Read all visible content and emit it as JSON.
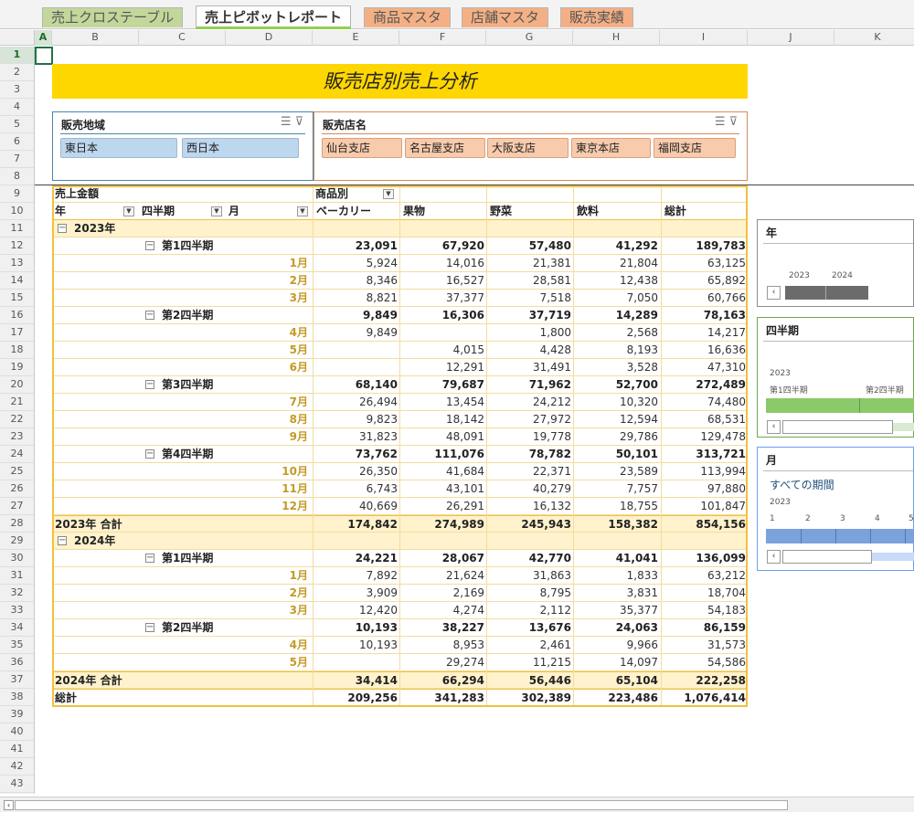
{
  "tabs": [
    {
      "label": "売上クロステーブル",
      "bg": "#c4d79b"
    },
    {
      "label": "売上ピボットレポート",
      "bg": "#ffffff"
    },
    {
      "label": "商品マスタ",
      "bg": "#f4b084"
    },
    {
      "label": "店舗マスタ",
      "bg": "#f4b084"
    },
    {
      "label": "販売実績",
      "bg": "#f4b084"
    }
  ],
  "columns": [
    "A",
    "B",
    "C",
    "D",
    "E",
    "F",
    "G",
    "H",
    "I",
    "J",
    "K"
  ],
  "rows": [
    "1",
    "2",
    "3",
    "4",
    "5",
    "6",
    "7",
    "8",
    "9",
    "10",
    "11",
    "12",
    "13",
    "14",
    "15",
    "16",
    "17",
    "18",
    "19",
    "20",
    "21",
    "22",
    "23",
    "24",
    "25",
    "26",
    "27",
    "28",
    "29",
    "30",
    "31",
    "32",
    "33",
    "34",
    "35",
    "36",
    "37",
    "38",
    "39",
    "40",
    "41",
    "42",
    "43"
  ],
  "banner": {
    "title": "販売店別売上分析"
  },
  "region_slicer": {
    "title": "販売地域",
    "items": [
      "東日本",
      "西日本"
    ]
  },
  "store_slicer": {
    "title": "販売店名",
    "items": [
      "仙台支店",
      "名古屋支店",
      "大阪支店",
      "東京本店",
      "福岡支店"
    ]
  },
  "pivot": {
    "value_label": "売上金額",
    "column_field": "商品別",
    "row_fields": [
      "年",
      "四半期",
      "月"
    ],
    "categories": [
      "ベーカリー",
      "果物",
      "野菜",
      "飲料",
      "総計"
    ],
    "rows": [
      {
        "type": "year",
        "label": "2023年",
        "values": [
          "",
          "",
          "",
          "",
          ""
        ]
      },
      {
        "type": "quarter",
        "label": "第1四半期",
        "values": [
          "23,091",
          "67,920",
          "57,480",
          "41,292",
          "189,783"
        ]
      },
      {
        "type": "month",
        "label": "1月",
        "values": [
          "5,924",
          "14,016",
          "21,381",
          "21,804",
          "63,125"
        ]
      },
      {
        "type": "month",
        "label": "2月",
        "values": [
          "8,346",
          "16,527",
          "28,581",
          "12,438",
          "65,892"
        ]
      },
      {
        "type": "month",
        "label": "3月",
        "values": [
          "8,821",
          "37,377",
          "7,518",
          "7,050",
          "60,766"
        ]
      },
      {
        "type": "quarter",
        "label": "第2四半期",
        "values": [
          "9,849",
          "16,306",
          "37,719",
          "14,289",
          "78,163"
        ]
      },
      {
        "type": "month",
        "label": "4月",
        "values": [
          "9,849",
          "",
          "1,800",
          "2,568",
          "14,217"
        ]
      },
      {
        "type": "month",
        "label": "5月",
        "values": [
          "",
          "4,015",
          "4,428",
          "8,193",
          "16,636"
        ]
      },
      {
        "type": "month",
        "label": "6月",
        "values": [
          "",
          "12,291",
          "31,491",
          "3,528",
          "47,310"
        ]
      },
      {
        "type": "quarter",
        "label": "第3四半期",
        "values": [
          "68,140",
          "79,687",
          "71,962",
          "52,700",
          "272,489"
        ]
      },
      {
        "type": "month",
        "label": "7月",
        "values": [
          "26,494",
          "13,454",
          "24,212",
          "10,320",
          "74,480"
        ]
      },
      {
        "type": "month",
        "label": "8月",
        "values": [
          "9,823",
          "18,142",
          "27,972",
          "12,594",
          "68,531"
        ]
      },
      {
        "type": "month",
        "label": "9月",
        "values": [
          "31,823",
          "48,091",
          "19,778",
          "29,786",
          "129,478"
        ]
      },
      {
        "type": "quarter",
        "label": "第4四半期",
        "values": [
          "73,762",
          "111,076",
          "78,782",
          "50,101",
          "313,721"
        ]
      },
      {
        "type": "month",
        "label": "10月",
        "values": [
          "26,350",
          "41,684",
          "22,371",
          "23,589",
          "113,994"
        ]
      },
      {
        "type": "month",
        "label": "11月",
        "values": [
          "6,743",
          "43,101",
          "40,279",
          "7,757",
          "97,880"
        ]
      },
      {
        "type": "month",
        "label": "12月",
        "values": [
          "40,669",
          "26,291",
          "16,132",
          "18,755",
          "101,847"
        ]
      },
      {
        "type": "yeartotal",
        "label": "2023年 合計",
        "values": [
          "174,842",
          "274,989",
          "245,943",
          "158,382",
          "854,156"
        ]
      },
      {
        "type": "year",
        "label": "2024年",
        "values": [
          "",
          "",
          "",
          "",
          ""
        ]
      },
      {
        "type": "quarter",
        "label": "第1四半期",
        "values": [
          "24,221",
          "28,067",
          "42,770",
          "41,041",
          "136,099"
        ]
      },
      {
        "type": "month",
        "label": "1月",
        "values": [
          "7,892",
          "21,624",
          "31,863",
          "1,833",
          "63,212"
        ]
      },
      {
        "type": "month",
        "label": "2月",
        "values": [
          "3,909",
          "2,169",
          "8,795",
          "3,831",
          "18,704"
        ]
      },
      {
        "type": "month",
        "label": "3月",
        "values": [
          "12,420",
          "4,274",
          "2,112",
          "35,377",
          "54,183"
        ]
      },
      {
        "type": "quarter",
        "label": "第2四半期",
        "values": [
          "10,193",
          "38,227",
          "13,676",
          "24,063",
          "86,159"
        ]
      },
      {
        "type": "month",
        "label": "4月",
        "values": [
          "10,193",
          "8,953",
          "2,461",
          "9,966",
          "31,573"
        ]
      },
      {
        "type": "month",
        "label": "5月",
        "values": [
          "",
          "29,274",
          "11,215",
          "14,097",
          "54,586"
        ]
      },
      {
        "type": "yeartotal",
        "label": "2024年 合計",
        "values": [
          "34,414",
          "66,294",
          "56,446",
          "65,104",
          "222,258"
        ]
      },
      {
        "type": "grandtotal",
        "label": "総計",
        "values": [
          "209,256",
          "341,283",
          "302,389",
          "223,486",
          "1,076,414"
        ]
      }
    ]
  },
  "year_timeline": {
    "title": "年",
    "labels": [
      "2023",
      "2024"
    ]
  },
  "quarter_timeline": {
    "title": "四半期",
    "year": "2023",
    "labels": [
      "第1四半期",
      "第2四半期"
    ]
  },
  "month_timeline": {
    "title": "月",
    "period_label": "すべての期間",
    "year": "2023",
    "labels": [
      "1",
      "2",
      "3",
      "4",
      "5"
    ]
  },
  "colors": {
    "accent": "#217346",
    "banner": "#ffd700",
    "band": "#fff2cc"
  }
}
